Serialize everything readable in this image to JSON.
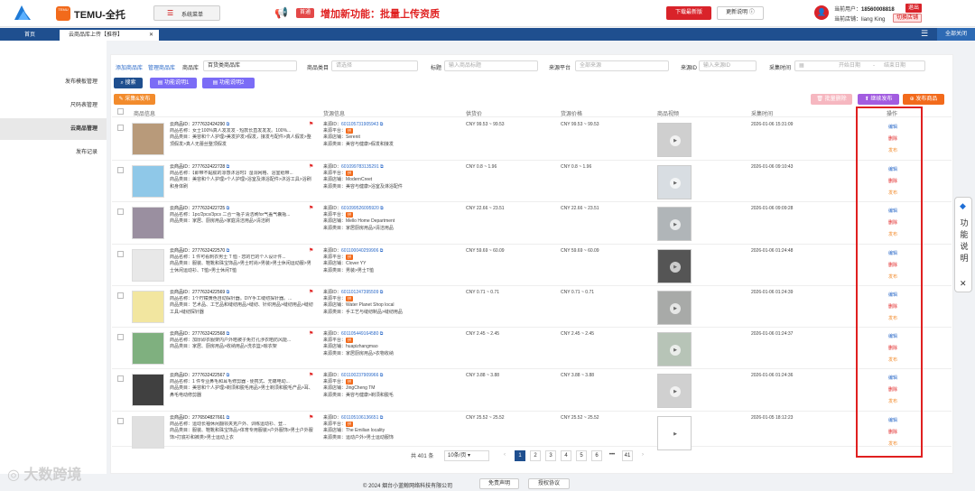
{
  "header": {
    "brand": "TEMU-全托",
    "sys_menu": "系统菜单",
    "first_badge": "首通",
    "announcement": "增加新功能：批量上传资质",
    "download_btn": "下载最新版",
    "update_btn": "更新说明 ⓘ",
    "current_user_label": "当前用户：",
    "current_user": "18560008818",
    "logout": "退出",
    "current_store_label": "当前店铺：",
    "current_store": "liang King",
    "switch_store": "切换店铺"
  },
  "tabs": {
    "home": "首页",
    "active": "云商品库上传【推荐】",
    "close_all": "全部关闭"
  },
  "sidebar": {
    "items": [
      {
        "label": "发布模板管理",
        "active": false
      },
      {
        "label": "尺码表管理",
        "active": false
      },
      {
        "label": "云商品管理",
        "active": true
      },
      {
        "label": "发布记录",
        "active": false
      }
    ]
  },
  "filters": {
    "add_link": "添加商品库",
    "manage_link": "管理商品库",
    "lib_label": "商品库",
    "lib_value": "百货类商品库",
    "cat_label": "商品类目",
    "cat_ph": "请选择",
    "title_label": "标题",
    "title_ph": "输入商品标题",
    "plat_label": "来源平台",
    "plat_value": "全部来源",
    "srcid_label": "来源ID",
    "srcid_ph": "输入来源ID",
    "time_label": "采集时间",
    "start_ph": "开始日期",
    "sep": "-",
    "end_ph": "结束日期",
    "search_btn": "搜索",
    "help1_btn": "功能说明1",
    "help2_btn": "功能说明2",
    "batch_pub_btn": "采集&发布",
    "batch_del_btn": "批量删除",
    "continue_btn": "继续发布",
    "publish_btn": "发布商品"
  },
  "table": {
    "headers": [
      "商品信息",
      "货源信息",
      "供货价",
      "货源价格",
      "商品视频",
      "采集时间",
      "操作"
    ],
    "cloud_id_label": "云商品ID：",
    "name_label": "商品名称：",
    "cat_label": "商品类目：",
    "src_id_label": "来源ID：",
    "src_plat_label": "来源平台：",
    "src_store_label": "来源店铺：",
    "src_cat_label": "来源类目：",
    "plat_tag": "拼",
    "op_edit": "编辑",
    "op_del": "删除",
    "op_pub": "发布",
    "rows": [
      {
        "cloud_id": "27776324242​90",
        "name": "女士100%真人发发发 - 短款长直发发发。100%...",
        "cat": "美容和个人护理>美发护发>假发，接发与配件>真人假发>整顶假发>真人无蕾丝整顶假发",
        "src_id": "601105731905943",
        "store": "Serenit",
        "scat": "美容与健康>假发和接发",
        "supply": "CNY 99.53 ~ 99.53",
        "sprice": "CNY 99.53 ~ 99.53",
        "time": "2026-01-06 15:31:09",
        "thumb": "#b89a7a",
        "vid": "#cfcfcf"
      },
      {
        "cloud_id": "2777632422728",
        "name": "【即带不黏腻的凉感沐浴时】湿洞网格、浴室纸带...",
        "cat": "美容和个人护理>个人护理>浴室及淋浴配件>沐浴工具>浴刷和身体刷",
        "src_id": "601099783135291",
        "store": "ModernCreet",
        "scat": "美容与健康>浴室及淋浴配件",
        "supply": "CNY 0.8 ~ 1.96",
        "sprice": "CNY 0.8 ~ 1.96",
        "time": "2026-01-06 09:10:43",
        "thumb": "#8fc8e8",
        "vid": "#d8dde2"
      },
      {
        "cloud_id": "2777632422725",
        "name": "1pc/2pcs/3pcs 二合一瓶子清洁刷for气盖气囊瓶...",
        "cat": "家居、厨房用品>家庭清洁用品>清洁刷",
        "src_id": "601099526095920",
        "store": "Mello Home Department",
        "scat": "家居厨房用品>清洁用品",
        "supply": "CNY 22.66 ~ 23.51",
        "sprice": "CNY 22.66 ~ 23.51",
        "time": "2026-01-06 09:09:28",
        "thumb": "#9a8fa0",
        "vid": "#b0b5b8"
      },
      {
        "cloud_id": "2777632422570",
        "name": "1 件可看刺衣男士 T 恤 - 您的已的个人设计件...",
        "cat": "服装、鞋靴和珠宝饰品>男士时尚>男装>男士休闲运动服>男士休闲运动衫、T恤>男士休闲T恤",
        "src_id": "601100040259906",
        "store": "Clover YY",
        "scat": "男装>男士T恤",
        "supply": "CNY 59.69 ~ 60.09",
        "sprice": "CNY 59.69 ~ 60.09",
        "time": "2026-01-06 01:24:48",
        "thumb": "#e8e8e8",
        "vid": "#555"
      },
      {
        "cloud_id": "2777632422569",
        "name": "1个柠檬黄色自动探针器。DIY手工缝纫探针器。...",
        "cat": "艺术品、工艺品和缝纫用品>缝纫、针织用品>缝纫用品>缝纫工具>缝纫探针器",
        "src_id": "601101247395509",
        "store": "Water Planet Shop local",
        "scat": "手工艺与缝纫制品>缝纫用品",
        "supply": "CNY 0.71 ~ 0.71",
        "sprice": "CNY 0.71 ~ 0.71",
        "time": "2026-01-06 01:24:39",
        "thumb": "#f2e6a0",
        "vid": "#a8aaa8"
      },
      {
        "cloud_id": "2777632422568",
        "name": "加厚即衣服架内户外晒被子免打孔涉衣晒防风能...",
        "cat": "家居、厨房用品>收纳用品>洗衣篮>晾衣架",
        "src_id": "601105449164580",
        "store": "huapizhangmao",
        "scat": "家居厨房用品>衣物收纳",
        "supply": "CNY 2.45 ~ 2.45",
        "sprice": "CNY 2.45 ~ 2.45",
        "time": "2026-01-06 01:24:37",
        "thumb": "#7fb07f",
        "vid": "#b7c4b7"
      },
      {
        "cloud_id": "2777632422567",
        "name": "1 件专业鼻毛和耳毛修剪器 - 便携式、无痛电动...",
        "cat": "美容和个人护理>剃须和脱毛用品>男士剃须和脱毛产品>耳、鼻毛电动修剪器",
        "src_id": "601100237909966",
        "store": "JingCheng TM",
        "scat": "美容与健康>剃须和脱毛",
        "supply": "CNY 3.88 ~ 3.88",
        "sprice": "CNY 3.88 ~ 3.88",
        "time": "2026-01-06 01:24:36",
        "thumb": "#404040",
        "vid": "#d0d0d0"
      },
      {
        "cloud_id": "2776504827661",
        "name": "运动长袖休闲翻领夹克户外、训练运动衫、登...",
        "cat": "服装、鞋靴和珠宝饰品>体育专用服装>户外服饰>男士户外服饰>打底衫和裤类>男士运动上衣",
        "src_id": "601105106136651",
        "store": "The Emilian locality",
        "scat": "运动户外>男士运动服饰",
        "supply": "CNY 25.52 ~ 25.52",
        "sprice": "CNY 25.52 ~ 25.52",
        "time": "2026-01-05 18:12:23",
        "thumb": "#e0e0e0",
        "vid": "#ffffff"
      }
    ]
  },
  "pagination": {
    "total": "共 401 条",
    "page_size": "10条/页",
    "prev": "‹",
    "pages": [
      "1",
      "2",
      "3",
      "4",
      "5",
      "6",
      "•••",
      "41"
    ],
    "next": "›"
  },
  "footer": {
    "copyright": "© 2024 烟台小蓝鲸网络科技有限公司",
    "disclaimer": "免责声明",
    "license": "授权协议"
  },
  "float_panel": {
    "text": "功能说明",
    "close": "✕"
  },
  "watermark": "大数跨境"
}
